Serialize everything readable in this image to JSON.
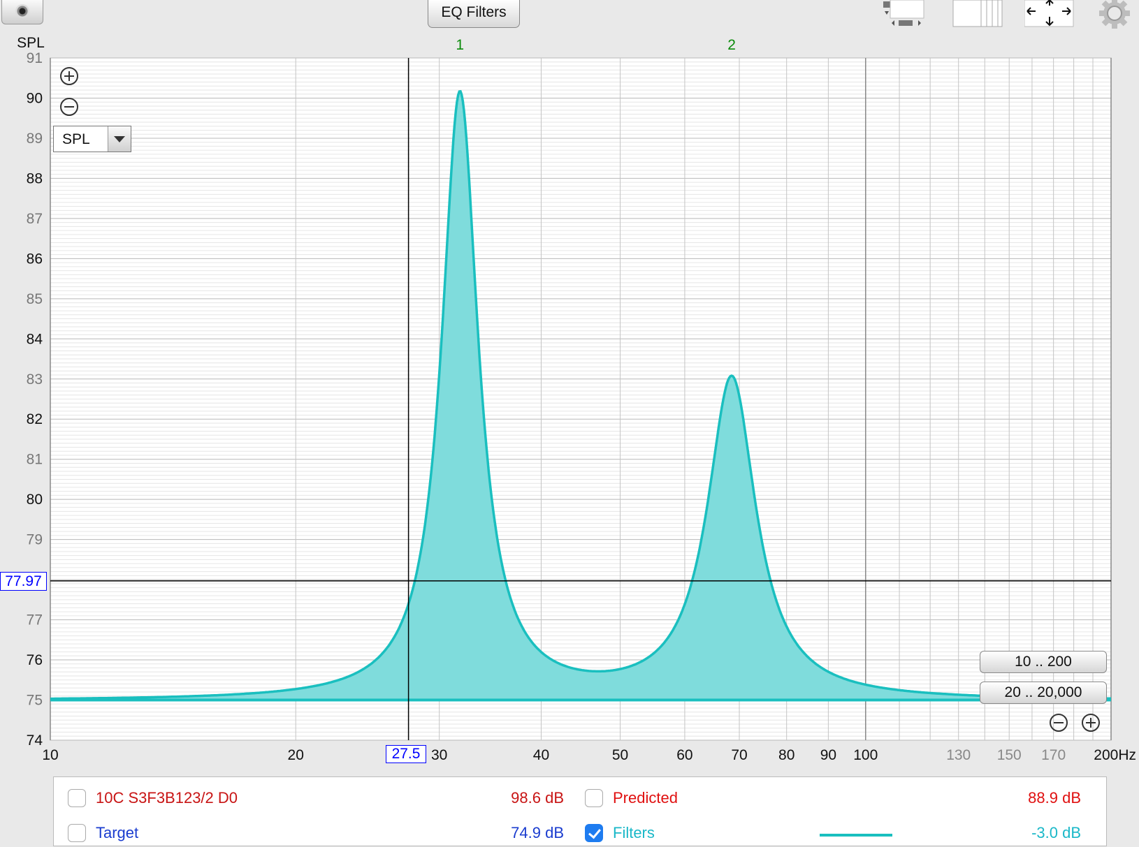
{
  "toolbar": {
    "eq_filters_label": "EQ Filters",
    "icons": [
      "camera-icon",
      "layout-icon",
      "columns-icon",
      "arrows-icon",
      "gear-icon"
    ]
  },
  "chart_data": {
    "type": "area",
    "ylabel": "SPL",
    "x_unit": "200Hz",
    "x_scale": "log",
    "xlim": [
      10,
      200
    ],
    "ylim": [
      74,
      91
    ],
    "y_ticks": [
      {
        "v": 91,
        "label": "91",
        "major": false
      },
      {
        "v": 90,
        "label": "90",
        "major": true
      },
      {
        "v": 89,
        "label": "89",
        "major": false
      },
      {
        "v": 88,
        "label": "88",
        "major": true
      },
      {
        "v": 87,
        "label": "87",
        "major": false
      },
      {
        "v": 86,
        "label": "86",
        "major": true
      },
      {
        "v": 85,
        "label": "85",
        "major": false
      },
      {
        "v": 84,
        "label": "84",
        "major": true
      },
      {
        "v": 83,
        "label": "83",
        "major": false
      },
      {
        "v": 82,
        "label": "82",
        "major": true
      },
      {
        "v": 81,
        "label": "81",
        "major": false
      },
      {
        "v": 80,
        "label": "80",
        "major": true
      },
      {
        "v": 79,
        "label": "79",
        "major": false
      },
      {
        "v": 77,
        "label": "77",
        "major": false
      },
      {
        "v": 76,
        "label": "76",
        "major": true
      },
      {
        "v": 75,
        "label": "75",
        "major": false
      },
      {
        "v": 74,
        "label": "74",
        "major": true
      }
    ],
    "x_ticks": [
      {
        "v": 10,
        "label": "10",
        "dim": false
      },
      {
        "v": 20,
        "label": "20",
        "dim": false
      },
      {
        "v": 30,
        "label": "30",
        "dim": false
      },
      {
        "v": 40,
        "label": "40",
        "dim": false
      },
      {
        "v": 50,
        "label": "50",
        "dim": false
      },
      {
        "v": 60,
        "label": "60",
        "dim": false
      },
      {
        "v": 70,
        "label": "70",
        "dim": false
      },
      {
        "v": 80,
        "label": "80",
        "dim": false
      },
      {
        "v": 90,
        "label": "90",
        "dim": false
      },
      {
        "v": 100,
        "label": "100",
        "dim": false
      },
      {
        "v": 130,
        "label": "130",
        "dim": true
      },
      {
        "v": 150,
        "label": "150",
        "dim": true
      },
      {
        "v": 170,
        "label": "170",
        "dim": true
      }
    ],
    "filter_markers": [
      {
        "label": "1",
        "x": 31.8
      },
      {
        "label": "2",
        "x": 68.5
      }
    ],
    "baseline": 75.0,
    "series": [
      {
        "name": "Filters",
        "color": "#1abfbf",
        "fill": "#7fdcdc",
        "peaks": [
          {
            "f": 31.8,
            "gain_db": 15.1,
            "q": 8
          },
          {
            "f": 68.5,
            "gain_db": 8.0,
            "q": 6
          }
        ]
      }
    ],
    "cursor": {
      "x": 27.5,
      "y": 77.97,
      "x_label": "27.5",
      "y_label": "77.97"
    },
    "grid": true
  },
  "controls": {
    "spl_select": "SPL",
    "range_buttons": [
      "10 .. 200",
      "20 .. 20,000"
    ]
  },
  "legend": {
    "rows": [
      [
        {
          "name": "10C S3F3B123/2 D0",
          "value": "98.6 dB",
          "checked": false,
          "color": "#c81414"
        },
        {
          "name": "Predicted",
          "value": "88.9 dB",
          "checked": false,
          "color": "#e01010"
        }
      ],
      [
        {
          "name": "Target",
          "value": "74.9 dB",
          "checked": false,
          "color": "#1a3ccf"
        },
        {
          "name": "Filters",
          "value": "-3.0 dB",
          "checked": true,
          "color": "#1ab8c8"
        }
      ]
    ]
  }
}
